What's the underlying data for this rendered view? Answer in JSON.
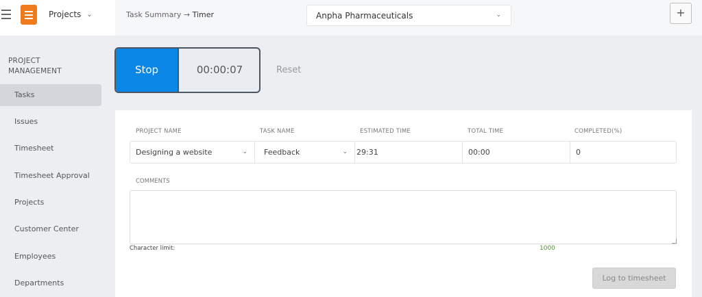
{
  "header": {
    "projects_label": "Projects",
    "breadcrumb": {
      "parent": "Task Summary",
      "arrow": "→",
      "current": "Timer"
    },
    "company": "Anpha Pharmaceuticals",
    "add_label": "+"
  },
  "sidebar": {
    "title_line1": "PROJECT",
    "title_line2": "MANAGEMENT",
    "items": [
      {
        "label": "Tasks",
        "active": true
      },
      {
        "label": "Issues"
      },
      {
        "label": "Timesheet"
      },
      {
        "label": "Timesheet Approval"
      },
      {
        "label": "Projects"
      },
      {
        "label": "Customer Center"
      },
      {
        "label": "Employees"
      },
      {
        "label": "Departments"
      }
    ]
  },
  "timer": {
    "stop_label": "Stop",
    "elapsed": "00:00:07",
    "reset_label": "Reset"
  },
  "form": {
    "columns": [
      "PROJECT NAME",
      "TASK NAME",
      "ESTIMATED TIME",
      "TOTAL TIME",
      "COMPLETED(%)"
    ],
    "project_name": "Designing a website",
    "task_name": "Feedback",
    "estimated_time": "29:31",
    "total_time": "00:00",
    "completed": "0",
    "comments_label": "COMMENTS",
    "comments_value": "",
    "char_limit_label": "Character limit:",
    "char_limit_value": "1000",
    "log_button": "Log to timesheet"
  },
  "colors": {
    "accent": "#0a86e6",
    "logo": "#f07b1c",
    "char_count": "#4a9a2a"
  }
}
